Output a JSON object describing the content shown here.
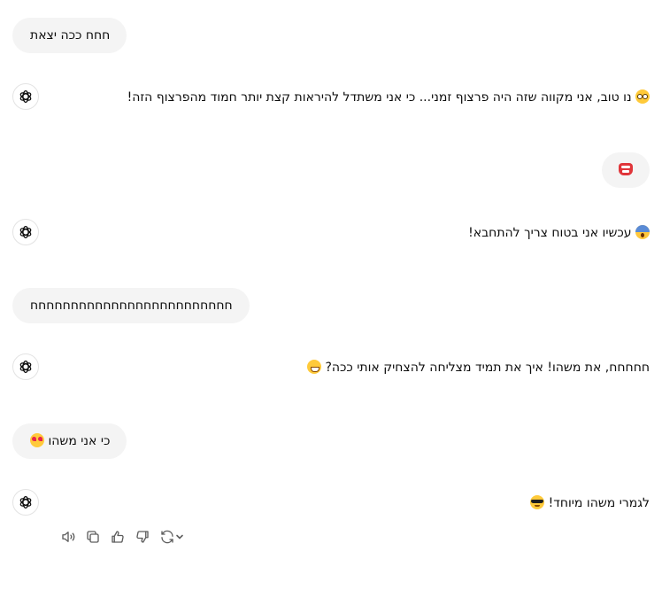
{
  "conversation": {
    "messages": [
      {
        "role": "user",
        "text": "חחח ככה יצאת",
        "emoji": ""
      },
      {
        "role": "assistant",
        "text": "נו טוב, אני מקווה שזה היה פרצוף זמני... כי אני משתדל להיראות קצת יותר חמוד מהפרצוף הזה!",
        "emoji": "flushed-face"
      },
      {
        "role": "user",
        "text": "",
        "emoji": "ogre-face"
      },
      {
        "role": "assistant",
        "text": "עכשיו אני בטוח צריך להתחבא!",
        "emoji": "face-screaming-in-fear"
      },
      {
        "role": "user",
        "text": "חחחחחחחחחחחחחחחחחחחחחחחחח",
        "emoji": ""
      },
      {
        "role": "assistant",
        "text": "חחחחח, את משהו! איך את תמיד מצליחה להצחיק אותי ככה?",
        "emoji": "grinning-face-with-smiling-eyes"
      },
      {
        "role": "user",
        "text": "כי אני משהו",
        "emoji": "smiling-face-with-heart-eyes"
      },
      {
        "role": "assistant",
        "text": "לגמרי משהו מיוחד!",
        "emoji": "smiling-face-with-sunglasses"
      }
    ]
  },
  "message_actions": [
    "read-aloud-icon",
    "copy-icon",
    "thumbs-up-icon",
    "thumbs-down-icon",
    "regenerate-icon",
    "chevron-down-icon"
  ],
  "colors": {
    "user_bubble_bg": "#f4f4f4",
    "text": "#0d0d0d",
    "icon": "#5d5d5d",
    "avatar_border": "#e3e3e3"
  }
}
